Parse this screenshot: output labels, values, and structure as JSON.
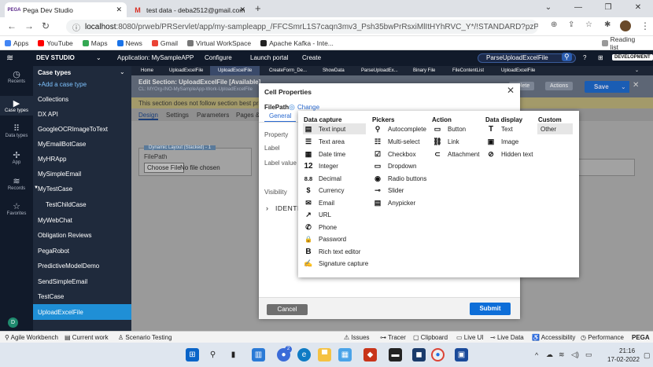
{
  "browser": {
    "tabs": [
      {
        "favicon": "PEGA",
        "title": "Pega Dev Studio"
      },
      {
        "favicon": "M",
        "title": "test data - deba2512@gmail.com"
      }
    ],
    "new_tab": "+",
    "url_host": "localhost",
    "url_rest": ":8080/prweb/PRServlet/app/my-sampleapp_/FFCSmrL1S7caqn3mv3_Psh35bwPrRsxiMlItHYhRVC_Y*/!STANDARD?pzPostData=4040826",
    "bookmarks": [
      "Apps",
      "YouTube",
      "Maps",
      "News",
      "Gmail",
      "Virtual WorkSpace",
      "Apache Kafka - Inte..."
    ],
    "reading_list": "Reading list"
  },
  "pega_header": {
    "studio": "DEV STUDIO",
    "application": "Application: MySampleAPP",
    "menus": [
      "Configure",
      "Launch portal",
      "Create"
    ],
    "search_value": "ParseUploadExcelFile",
    "developer_badge": "DEVELOPMENT",
    "avatar": "D"
  },
  "rail": [
    {
      "icon": "recents-icon",
      "label": "Recents"
    },
    {
      "icon": "case-types-icon",
      "label": "Case types"
    },
    {
      "icon": "data-types-icon",
      "label": "Data types"
    },
    {
      "icon": "app-icon",
      "label": "App"
    },
    {
      "icon": "records-icon",
      "label": "Records"
    },
    {
      "icon": "favorites-icon",
      "label": "Favorites"
    }
  ],
  "case_panel": {
    "title": "Case types",
    "add": "+Add a case type",
    "items": [
      "Collections",
      "DX API",
      "GoogleOCRImageToText",
      "MyEmailBotCase",
      "MyHRApp",
      "MySimpleEmail",
      "MyTestCase",
      "TestChildCase",
      "MyWebChat",
      "Obligation Reviews",
      "PegaRobot",
      "PredictiveModelDemo",
      "SendSimpleEmail",
      "TestCase",
      "UploadExcelFile"
    ]
  },
  "doc_tabs": [
    "Home",
    "UploadExcelFile",
    "UploadExcelFile",
    "CreateForm_De...",
    "ShowData",
    "ParseUploadEx...",
    "Binary File",
    "FileContentList",
    "UploadExcelFile"
  ],
  "editor": {
    "title": "Edit  Section: UploadExcelFile [Available]",
    "subtitle": "CL: MYOrg-INO-MySampleApp-Work-UploadExcelFile",
    "warning": "This section does not follow section best practices",
    "tabs": [
      "Design",
      "Settings",
      "Parameters",
      "Pages &"
    ],
    "layout_label": "Dynamic Layout (Stacked) - 1",
    "field_label": "FilePath",
    "choose_file": "Choose File",
    "no_file": "No file chosen",
    "delete": "Delete",
    "actions": "Actions",
    "save": "Save"
  },
  "modal": {
    "title": "Cell Properties",
    "field": "FilePath",
    "change": "Change",
    "tab": "General",
    "labels": [
      "Property",
      "Label",
      "Label value",
      "Visibility"
    ],
    "identifier": "IDENTIF",
    "cancel": "Cancel",
    "submit": "Submit"
  },
  "picker": {
    "columns": [
      {
        "heading": "Data capture",
        "items": [
          {
            "icon": "text-input-icon",
            "glyph": "▤",
            "label": "Text input"
          },
          {
            "icon": "text-area-icon",
            "glyph": "☰",
            "label": "Text area"
          },
          {
            "icon": "date-time-icon",
            "glyph": "▦",
            "label": "Date time"
          },
          {
            "icon": "integer-icon",
            "glyph": "12",
            "label": "Integer"
          },
          {
            "icon": "decimal-icon",
            "glyph": "8.8",
            "label": "Decimal"
          },
          {
            "icon": "currency-icon",
            "glyph": "$",
            "label": "Currency"
          },
          {
            "icon": "email-icon",
            "glyph": "✉",
            "label": "Email"
          },
          {
            "icon": "url-icon",
            "glyph": "↗",
            "label": "URL"
          },
          {
            "icon": "phone-icon",
            "glyph": "✆",
            "label": "Phone"
          },
          {
            "icon": "password-icon",
            "glyph": "🔒",
            "label": "Password"
          },
          {
            "icon": "rich-text-icon",
            "glyph": "B",
            "label": "Rich text editor"
          },
          {
            "icon": "signature-icon",
            "glyph": "✍",
            "label": "Signature capture"
          }
        ]
      },
      {
        "heading": "Pickers",
        "items": [
          {
            "icon": "autocomplete-icon",
            "glyph": "⚲",
            "label": "Autocomplete"
          },
          {
            "icon": "multi-select-icon",
            "glyph": "☷",
            "label": "Multi-select"
          },
          {
            "icon": "checkbox-icon",
            "glyph": "☑",
            "label": "Checkbox"
          },
          {
            "icon": "dropdown-icon",
            "glyph": "▭",
            "label": "Dropdown"
          },
          {
            "icon": "radio-buttons-icon",
            "glyph": "◉",
            "label": "Radio buttons"
          },
          {
            "icon": "slider-icon",
            "glyph": "⊸",
            "label": "Slider"
          },
          {
            "icon": "anypicker-icon",
            "glyph": "▤",
            "label": "Anypicker"
          }
        ]
      },
      {
        "heading": "Action",
        "items": [
          {
            "icon": "button-icon",
            "glyph": "▭",
            "label": "Button"
          },
          {
            "icon": "link-icon",
            "glyph": "⛓",
            "label": "Link"
          },
          {
            "icon": "attachment-icon",
            "glyph": "⊂",
            "label": "Attachment"
          }
        ]
      },
      {
        "heading": "Data display",
        "items": [
          {
            "icon": "text-display-icon",
            "glyph": "T",
            "label": "Text"
          },
          {
            "icon": "image-icon",
            "glyph": "▣",
            "label": "Image"
          },
          {
            "icon": "hidden-text-icon",
            "glyph": "⊘",
            "label": "Hidden text"
          }
        ]
      },
      {
        "heading": "Custom",
        "items": [
          {
            "icon": "other-icon",
            "glyph": "",
            "label": "Other"
          }
        ]
      }
    ]
  },
  "status_bar": {
    "left": [
      "Agile Workbench",
      "Current work",
      "Scenario Testing"
    ],
    "right": [
      "Issues",
      "Tracer",
      "Clipboard",
      "Live UI",
      "Live Data",
      "Accessibility",
      "Performance",
      "PEGA"
    ]
  },
  "taskbar": {
    "time": "21:16",
    "date": "17-02-2022",
    "badge": "2"
  },
  "colors": {
    "pega_dark": "#111a2a",
    "panel": "#1f2a3c",
    "selected": "#1f8fd6",
    "submit": "#0e6ed8",
    "accent_purple": "#5d2b8c"
  }
}
